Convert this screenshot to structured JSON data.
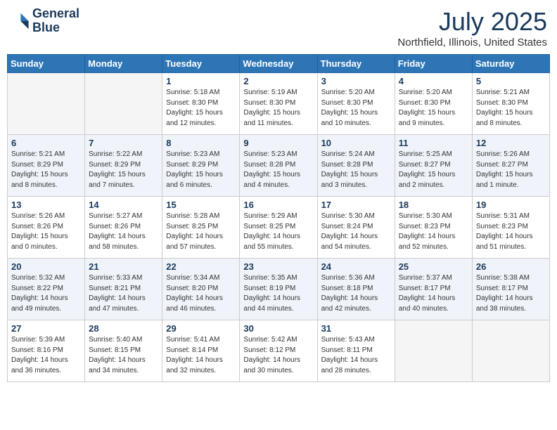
{
  "header": {
    "logo_line1": "General",
    "logo_line2": "Blue",
    "month_title": "July 2025",
    "location": "Northfield, Illinois, United States"
  },
  "weekdays": [
    "Sunday",
    "Monday",
    "Tuesday",
    "Wednesday",
    "Thursday",
    "Friday",
    "Saturday"
  ],
  "weeks": [
    [
      {
        "num": "",
        "info": ""
      },
      {
        "num": "",
        "info": ""
      },
      {
        "num": "1",
        "info": "Sunrise: 5:18 AM\nSunset: 8:30 PM\nDaylight: 15 hours\nand 12 minutes."
      },
      {
        "num": "2",
        "info": "Sunrise: 5:19 AM\nSunset: 8:30 PM\nDaylight: 15 hours\nand 11 minutes."
      },
      {
        "num": "3",
        "info": "Sunrise: 5:20 AM\nSunset: 8:30 PM\nDaylight: 15 hours\nand 10 minutes."
      },
      {
        "num": "4",
        "info": "Sunrise: 5:20 AM\nSunset: 8:30 PM\nDaylight: 15 hours\nand 9 minutes."
      },
      {
        "num": "5",
        "info": "Sunrise: 5:21 AM\nSunset: 8:30 PM\nDaylight: 15 hours\nand 8 minutes."
      }
    ],
    [
      {
        "num": "6",
        "info": "Sunrise: 5:21 AM\nSunset: 8:29 PM\nDaylight: 15 hours\nand 8 minutes."
      },
      {
        "num": "7",
        "info": "Sunrise: 5:22 AM\nSunset: 8:29 PM\nDaylight: 15 hours\nand 7 minutes."
      },
      {
        "num": "8",
        "info": "Sunrise: 5:23 AM\nSunset: 8:29 PM\nDaylight: 15 hours\nand 6 minutes."
      },
      {
        "num": "9",
        "info": "Sunrise: 5:23 AM\nSunset: 8:28 PM\nDaylight: 15 hours\nand 4 minutes."
      },
      {
        "num": "10",
        "info": "Sunrise: 5:24 AM\nSunset: 8:28 PM\nDaylight: 15 hours\nand 3 minutes."
      },
      {
        "num": "11",
        "info": "Sunrise: 5:25 AM\nSunset: 8:27 PM\nDaylight: 15 hours\nand 2 minutes."
      },
      {
        "num": "12",
        "info": "Sunrise: 5:26 AM\nSunset: 8:27 PM\nDaylight: 15 hours\nand 1 minute."
      }
    ],
    [
      {
        "num": "13",
        "info": "Sunrise: 5:26 AM\nSunset: 8:26 PM\nDaylight: 15 hours\nand 0 minutes."
      },
      {
        "num": "14",
        "info": "Sunrise: 5:27 AM\nSunset: 8:26 PM\nDaylight: 14 hours\nand 58 minutes."
      },
      {
        "num": "15",
        "info": "Sunrise: 5:28 AM\nSunset: 8:25 PM\nDaylight: 14 hours\nand 57 minutes."
      },
      {
        "num": "16",
        "info": "Sunrise: 5:29 AM\nSunset: 8:25 PM\nDaylight: 14 hours\nand 55 minutes."
      },
      {
        "num": "17",
        "info": "Sunrise: 5:30 AM\nSunset: 8:24 PM\nDaylight: 14 hours\nand 54 minutes."
      },
      {
        "num": "18",
        "info": "Sunrise: 5:30 AM\nSunset: 8:23 PM\nDaylight: 14 hours\nand 52 minutes."
      },
      {
        "num": "19",
        "info": "Sunrise: 5:31 AM\nSunset: 8:23 PM\nDaylight: 14 hours\nand 51 minutes."
      }
    ],
    [
      {
        "num": "20",
        "info": "Sunrise: 5:32 AM\nSunset: 8:22 PM\nDaylight: 14 hours\nand 49 minutes."
      },
      {
        "num": "21",
        "info": "Sunrise: 5:33 AM\nSunset: 8:21 PM\nDaylight: 14 hours\nand 47 minutes."
      },
      {
        "num": "22",
        "info": "Sunrise: 5:34 AM\nSunset: 8:20 PM\nDaylight: 14 hours\nand 46 minutes."
      },
      {
        "num": "23",
        "info": "Sunrise: 5:35 AM\nSunset: 8:19 PM\nDaylight: 14 hours\nand 44 minutes."
      },
      {
        "num": "24",
        "info": "Sunrise: 5:36 AM\nSunset: 8:18 PM\nDaylight: 14 hours\nand 42 minutes."
      },
      {
        "num": "25",
        "info": "Sunrise: 5:37 AM\nSunset: 8:17 PM\nDaylight: 14 hours\nand 40 minutes."
      },
      {
        "num": "26",
        "info": "Sunrise: 5:38 AM\nSunset: 8:17 PM\nDaylight: 14 hours\nand 38 minutes."
      }
    ],
    [
      {
        "num": "27",
        "info": "Sunrise: 5:39 AM\nSunset: 8:16 PM\nDaylight: 14 hours\nand 36 minutes."
      },
      {
        "num": "28",
        "info": "Sunrise: 5:40 AM\nSunset: 8:15 PM\nDaylight: 14 hours\nand 34 minutes."
      },
      {
        "num": "29",
        "info": "Sunrise: 5:41 AM\nSunset: 8:14 PM\nDaylight: 14 hours\nand 32 minutes."
      },
      {
        "num": "30",
        "info": "Sunrise: 5:42 AM\nSunset: 8:12 PM\nDaylight: 14 hours\nand 30 minutes."
      },
      {
        "num": "31",
        "info": "Sunrise: 5:43 AM\nSunset: 8:11 PM\nDaylight: 14 hours\nand 28 minutes."
      },
      {
        "num": "",
        "info": ""
      },
      {
        "num": "",
        "info": ""
      }
    ]
  ]
}
